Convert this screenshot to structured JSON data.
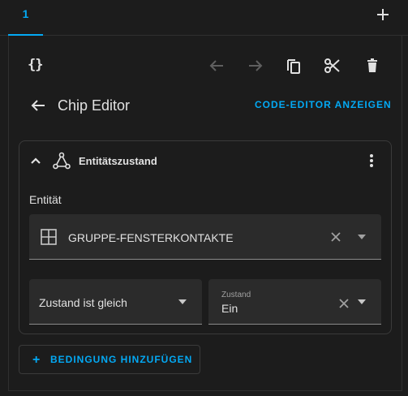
{
  "tabs": [
    {
      "label": "1"
    }
  ],
  "toolbar": {
    "code_icon": "{}",
    "undo_icon": "arrow-left-icon",
    "redo_icon": "arrow-right-icon",
    "copy_icon": "copy-icon",
    "cut_icon": "scissors-icon",
    "delete_icon": "trash-icon"
  },
  "editor": {
    "title": "Chip Editor",
    "code_editor_label": "CODE-EDITOR ANZEIGEN"
  },
  "condition": {
    "title": "Entitätszustand",
    "entity_label": "Entität",
    "entity_value": "GRUPPE-FENSTERKONTAKTE",
    "operator_value": "Zustand ist gleich",
    "state_label": "Zustand",
    "state_value": "Ein"
  },
  "add_condition_label": "BEDINGUNG HINZUFÜGEN",
  "colors": {
    "accent": "#03a9f4",
    "background": "#1c1c1c",
    "field": "#2b2b2b",
    "text": "#e1e1e1"
  }
}
